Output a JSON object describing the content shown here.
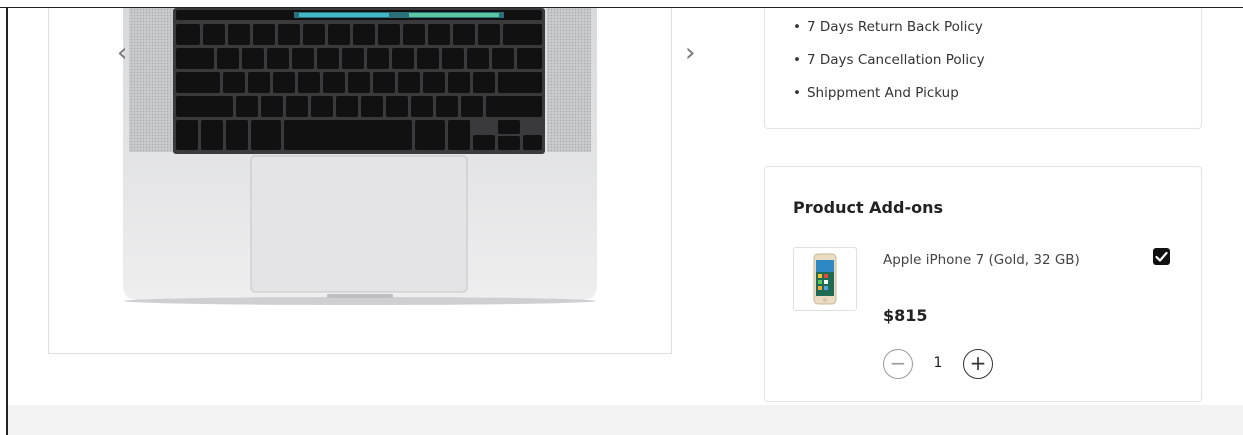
{
  "gallery": {
    "prev_icon": "chevron-left-icon",
    "next_icon": "chevron-right-icon",
    "prev_glyph": "‹",
    "next_glyph": "›",
    "image_subject": "laptop"
  },
  "policies": [
    "7 Days Return Back Policy",
    "7 Days Cancellation Policy",
    "Shippment And Pickup"
  ],
  "addons": {
    "title": "Product Add-ons",
    "items": [
      {
        "name": "Apple iPhone 7 (Gold, 32 GB)",
        "price": "$815",
        "quantity": "1",
        "selected": true,
        "minus_glyph": "−",
        "plus_glyph": "+"
      }
    ]
  },
  "colors": {
    "checkbox": "#111111",
    "border": "#e3e3e3",
    "footer_strip": "#f3f3f3"
  }
}
